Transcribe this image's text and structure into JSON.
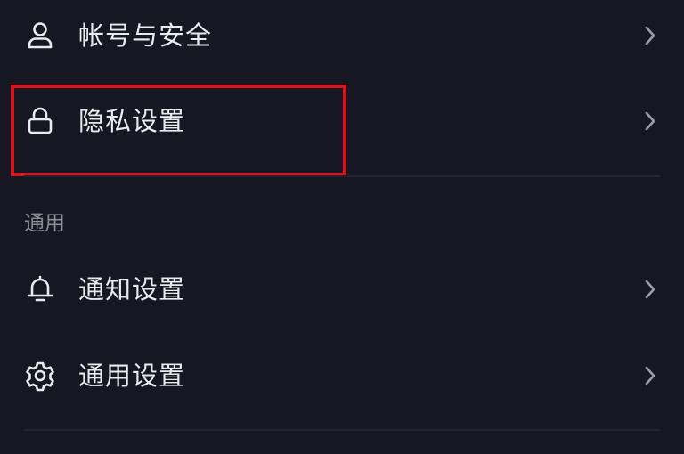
{
  "settings": {
    "items": [
      {
        "label": "帐号与安全",
        "icon": "user-icon"
      },
      {
        "label": "隐私设置",
        "icon": "lock-icon",
        "highlighted": true
      },
      {
        "label": "通知设置",
        "icon": "bell-icon"
      },
      {
        "label": "通用设置",
        "icon": "gear-icon"
      }
    ],
    "sections": {
      "general_header": "通用"
    }
  },
  "colors": {
    "background": "#161722",
    "text_primary": "#e9e9ee",
    "text_secondary": "#8b8c96",
    "chevron": "#9a9ba4",
    "divider": "#23242f",
    "highlight_border": "#d9141c"
  }
}
